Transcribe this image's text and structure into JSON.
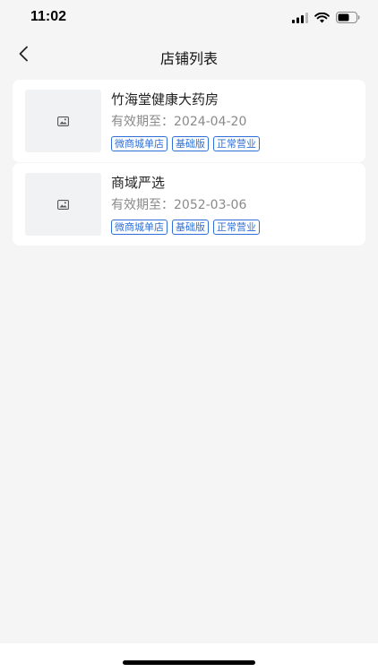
{
  "status_bar": {
    "time": "11:02",
    "icons": [
      "signal-icon",
      "wifi-icon",
      "battery-icon"
    ]
  },
  "nav": {
    "back_icon": "chevron-left-icon",
    "title": "店铺列表"
  },
  "stores": [
    {
      "name": "竹海堂健康大药房",
      "expiry": "有效期至：2024-04-20",
      "image_icon": "image-placeholder-icon",
      "tags": [
        "微商城单店",
        "基础版",
        "正常营业"
      ]
    },
    {
      "name": "商域严选",
      "expiry": "有效期至：2052-03-06",
      "image_icon": "image-placeholder-icon",
      "tags": [
        "微商城单店",
        "基础版",
        "正常营业"
      ]
    }
  ],
  "colors": {
    "background": "#f5f5f5",
    "card": "#ffffff",
    "tag_accent": "#2f6fd7",
    "muted_text": "#8a8a8a"
  }
}
